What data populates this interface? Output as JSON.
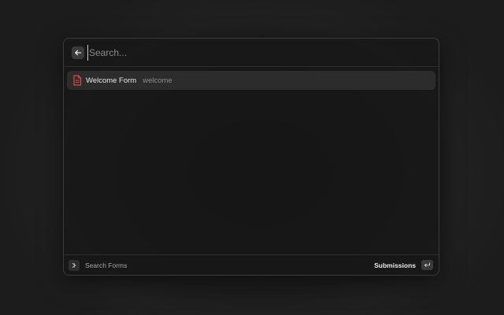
{
  "search": {
    "placeholder": "Search..."
  },
  "list": {
    "items": [
      {
        "title": "Welcome Form",
        "subtitle": "welcome",
        "icon": "document-icon"
      }
    ]
  },
  "footer": {
    "label": "Search Forms",
    "action_label": "Submissions",
    "action_key_icon": "enter-key-icon"
  },
  "colors": {
    "accent": "#e0473e",
    "selected_row": "#2c2c2c",
    "window_border": "#3a3a3a"
  }
}
